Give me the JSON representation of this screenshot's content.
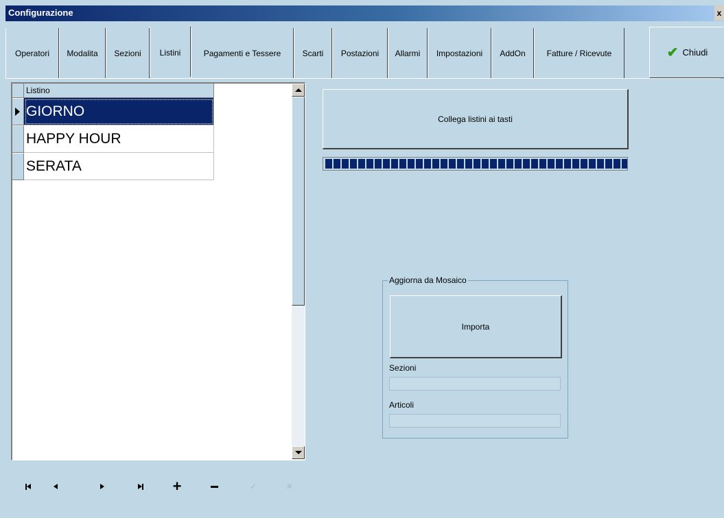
{
  "window": {
    "title": "Configurazione",
    "close_glyph": "x"
  },
  "tabs": [
    {
      "label": "Operatori",
      "active": false
    },
    {
      "label": "Modalita",
      "active": false
    },
    {
      "label": "Sezioni",
      "active": false
    },
    {
      "label": "Listini",
      "active": true
    },
    {
      "label": "Pagamenti e Tessere",
      "active": false
    },
    {
      "label": "Scarti",
      "active": false
    },
    {
      "label": "Postazioni",
      "active": false
    },
    {
      "label": "Allarmi",
      "active": false
    },
    {
      "label": "Impostazioni",
      "active": false
    },
    {
      "label": "AddOn",
      "active": false
    },
    {
      "label": "Fatture / Ricevute",
      "active": false
    }
  ],
  "close_button": {
    "label": "Chiudi",
    "icon": "check-icon"
  },
  "grid": {
    "column_header": "Listino",
    "rows": [
      "GIORNO",
      "HAPPY HOUR",
      "SERATA"
    ],
    "selected_index": 0
  },
  "navigator": {
    "buttons": [
      {
        "name": "first-button",
        "icon": "first-icon",
        "enabled": true
      },
      {
        "name": "prior-button",
        "icon": "prior-icon",
        "enabled": true
      },
      {
        "name": "next-button",
        "icon": "next-icon",
        "enabled": true
      },
      {
        "name": "last-button",
        "icon": "last-icon",
        "enabled": true
      },
      {
        "name": "insert-button",
        "icon": "plus-icon",
        "enabled": true
      },
      {
        "name": "delete-button",
        "icon": "minus-icon",
        "enabled": true
      },
      {
        "name": "post-button",
        "icon": "check-icon",
        "enabled": false
      },
      {
        "name": "cancel-button",
        "icon": "cancel-icon",
        "enabled": false
      }
    ],
    "glyphs": {
      "post": "✓",
      "cancel": "✕"
    }
  },
  "link_button": {
    "label": "Collega listini ai tasti"
  },
  "progress": {
    "fraction": 1.0
  },
  "import_group": {
    "title": "Aggiorna da Mosaico",
    "import_label": "Importa",
    "sezioni_label": "Sezioni",
    "articoli_label": "Articoli",
    "sezioni_value": "",
    "articoli_value": ""
  },
  "colors": {
    "background": "#c0d8e6",
    "selection": "#0a246a",
    "progress": "#0a246a",
    "check": "#2f9a16"
  }
}
